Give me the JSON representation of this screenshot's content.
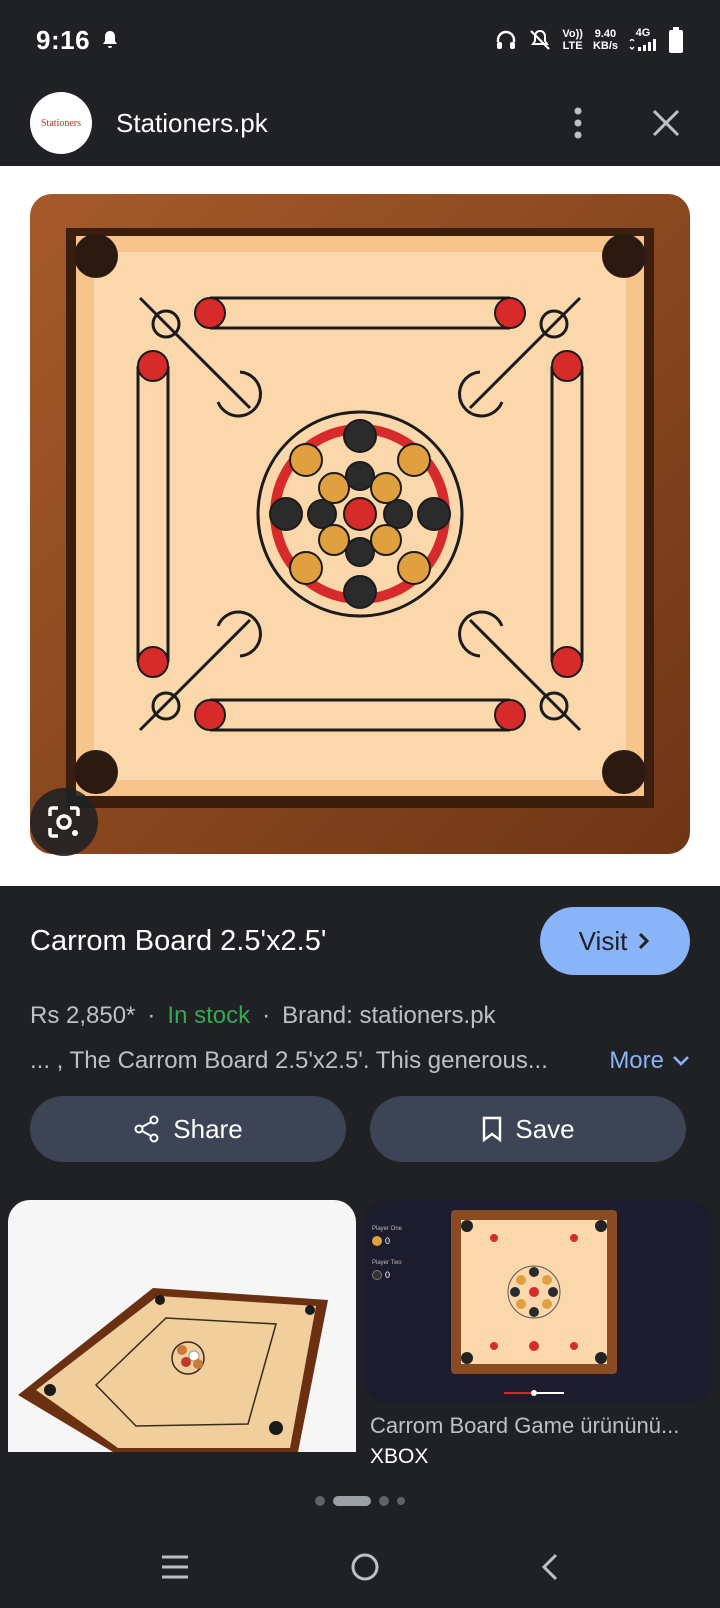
{
  "status": {
    "time": "9:16",
    "volte_top": "Vo))",
    "volte_bottom": "LTE",
    "speed_top": "9.40",
    "speed_bottom": "KB/s",
    "net": "4G"
  },
  "header": {
    "site_name": "Stationers.pk",
    "logo_text": "Stationers"
  },
  "product": {
    "title": "Carrom Board 2.5'x2.5'",
    "visit_label": "Visit",
    "price": "Rs 2,850*",
    "separator": "·",
    "stock": "In stock",
    "brand": "Brand: stationers.pk",
    "description": "... , The Carrom Board 2.5'x2.5'. This generous...",
    "more_label": "More"
  },
  "actions": {
    "share_label": "Share",
    "save_label": "Save"
  },
  "related": {
    "card2_title": "Carrom Board Game ürününü...",
    "card2_source": "XBOX",
    "card2_player_one": "Player One",
    "card2_player_two": "Player Two",
    "card2_score_one": "0",
    "card2_score_two": "0"
  },
  "colors": {
    "accent": "#8ab4f8",
    "stock": "#34a853",
    "button_bg": "#3c4455"
  },
  "icons": [
    "bell-icon",
    "headphones-icon",
    "mute-icon",
    "signal-icon",
    "battery-icon",
    "more-vert-icon",
    "close-icon",
    "lens-icon",
    "chevron-right-icon",
    "chevron-down-icon",
    "share-icon",
    "bookmark-icon",
    "menu-icon",
    "home-icon",
    "back-icon"
  ]
}
